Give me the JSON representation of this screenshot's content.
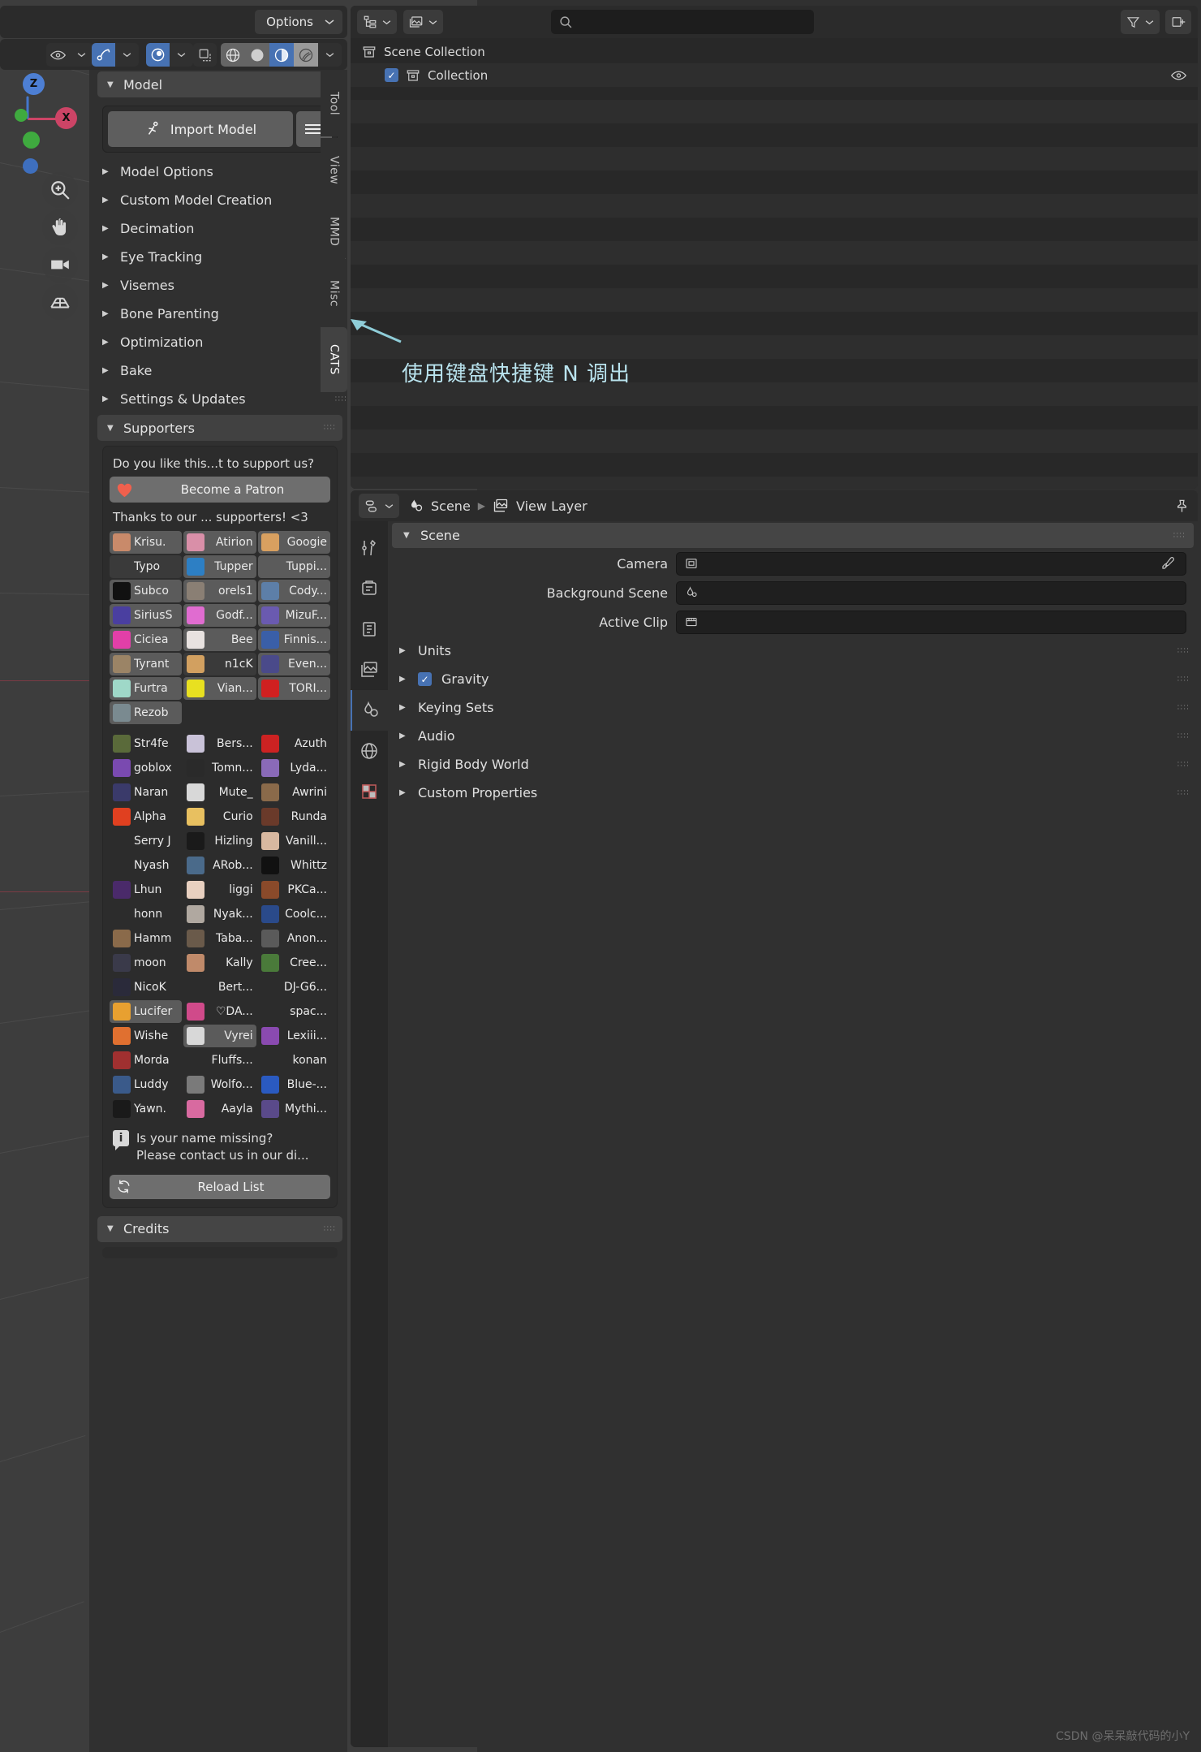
{
  "viewport": {
    "options_label": "Options",
    "gizmo": {
      "z": "Z",
      "x": "X"
    },
    "tools": [
      "zoom-tool",
      "pan-tool",
      "camera-tool",
      "grid-tool"
    ],
    "header_icons": [
      "visibility-dropdown",
      "snap-magnet",
      "snap-dropdown",
      "proportional-edit",
      "proportional-dropdown",
      "overlays-toggle",
      "wireframe-shading",
      "solid-shading",
      "material-shading",
      "rendered-shading",
      "shading-dropdown"
    ]
  },
  "cats_panel": {
    "tabs": [
      {
        "label": "Tool",
        "active": false
      },
      {
        "label": "View",
        "active": false
      },
      {
        "label": "MMD",
        "active": false
      },
      {
        "label": "Misc",
        "active": false
      },
      {
        "label": "CATS",
        "active": true
      }
    ],
    "model_header": "Model",
    "import_button": "Import Model",
    "sections": [
      {
        "label": "Model Options",
        "open": false
      },
      {
        "label": "Custom Model Creation",
        "open": false
      },
      {
        "label": "Decimation",
        "open": false
      },
      {
        "label": "Eye Tracking",
        "open": false
      },
      {
        "label": "Visemes",
        "open": false
      },
      {
        "label": "Bone Parenting",
        "open": false
      },
      {
        "label": "Optimization",
        "open": false
      },
      {
        "label": "Bake",
        "open": false
      },
      {
        "label": "Settings & Updates",
        "open": false
      },
      {
        "label": "Supporters",
        "open": true
      }
    ],
    "supporters": {
      "prompt": "Do you like this...t to support us?",
      "patron_button": "Become a Patron",
      "patron_icon": "heart-icon",
      "thanks": "Thanks to our ... supporters! <3",
      "top_rows": [
        [
          {
            "name": "Krisu.",
            "avatar": "#c98a6a",
            "style": "light"
          },
          {
            "name": "Atirion",
            "avatar": "#d98fa8",
            "style": "light"
          },
          {
            "name": "Googie",
            "avatar": "#d8a060",
            "style": "light"
          }
        ],
        [
          {
            "name": "Typo",
            "avatar": "",
            "style": "dark"
          },
          {
            "name": "Tupper",
            "avatar": "#2d7fc4",
            "style": "light"
          },
          {
            "name": "Tuppi...",
            "avatar": "",
            "style": "light"
          }
        ],
        [
          {
            "name": "Subco",
            "avatar": "#111111",
            "style": "light"
          },
          {
            "name": "orels1",
            "avatar": "#8a7f74",
            "style": "light"
          },
          {
            "name": "Cody...",
            "avatar": "#5d7fa8",
            "style": "light"
          }
        ],
        [
          {
            "name": "SiriusS",
            "avatar": "#4a3fa0",
            "style": "light"
          },
          {
            "name": "Godf...",
            "avatar": "#e06cd0",
            "style": "light"
          },
          {
            "name": "MizuF...",
            "avatar": "#6a5ab0",
            "style": "light"
          }
        ],
        [
          {
            "name": "Ciciea",
            "avatar": "#e23fa8",
            "style": "light"
          },
          {
            "name": "Bee",
            "avatar": "#e8e2e0",
            "style": "light"
          },
          {
            "name": "Finnis...",
            "avatar": "#3a5fa8",
            "style": "light"
          }
        ],
        [
          {
            "name": "Tyrant",
            "avatar": "#9b8466",
            "style": "light"
          },
          {
            "name": "n1cK",
            "avatar": "#d2a060",
            "style": "dark"
          },
          {
            "name": "Even...",
            "avatar": "#4a4a8a",
            "style": "light"
          }
        ],
        [
          {
            "name": "Furtra",
            "avatar": "#9fd8c8",
            "style": "light"
          },
          {
            "name": "Vian...",
            "avatar": "#e8e020",
            "style": "light"
          },
          {
            "name": "TORI...",
            "avatar": "#d02020",
            "style": "light"
          }
        ],
        [
          {
            "name": "Rezob",
            "avatar": "#7a8a90",
            "style": "light"
          },
          {
            "name": "",
            "avatar": "",
            "style": "flat"
          },
          {
            "name": "",
            "avatar": "",
            "style": "flat"
          }
        ]
      ],
      "bottom_rows": [
        [
          {
            "name": "Str4fe",
            "avatar": "#5a6a3a"
          },
          {
            "name": "Bers...",
            "avatar": "#c9c2d8"
          },
          {
            "name": "Azuth",
            "avatar": "#cc2222"
          }
        ],
        [
          {
            "name": "goblox",
            "avatar": "#7a4ab0"
          },
          {
            "name": "Tomn...",
            "avatar": "#2a2a2a"
          },
          {
            "name": "Lyda...",
            "avatar": "#8a6ab8"
          }
        ],
        [
          {
            "name": "Naran",
            "avatar": "#3a3a6a"
          },
          {
            "name": "Mute_",
            "avatar": "#d8d8d8"
          },
          {
            "name": "Awrini",
            "avatar": "#8a6a4a"
          }
        ],
        [
          {
            "name": "Alpha",
            "avatar": "#e04020"
          },
          {
            "name": "Curio",
            "avatar": "#e8c060"
          },
          {
            "name": "Runda",
            "avatar": "#6a3a2a"
          }
        ],
        [
          {
            "name": "Serry J",
            "avatar": ""
          },
          {
            "name": "Hizling",
            "avatar": "#1a1a1a"
          },
          {
            "name": "Vanill...",
            "avatar": "#d8b8a0"
          }
        ],
        [
          {
            "name": "Nyash",
            "avatar": ""
          },
          {
            "name": "ARob...",
            "avatar": "#4a6a8a"
          },
          {
            "name": "Whittz",
            "avatar": "#111111"
          }
        ],
        [
          {
            "name": "Lhun",
            "avatar": "#4a2a6a"
          },
          {
            "name": "liggi",
            "avatar": "#e8d0c0"
          },
          {
            "name": "PKCa...",
            "avatar": "#8a4a2a"
          }
        ],
        [
          {
            "name": "honn",
            "avatar": ""
          },
          {
            "name": "Nyak...",
            "avatar": "#b0a8a0"
          },
          {
            "name": "Coolc...",
            "avatar": "#2a4a8a"
          }
        ],
        [
          {
            "name": "Hamm",
            "avatar": "#8a6a4a"
          },
          {
            "name": "Taba...",
            "avatar": "#6a5a4a"
          },
          {
            "name": "Anon...",
            "avatar": "#5a5a5a"
          }
        ],
        [
          {
            "name": "moon",
            "avatar": "#3a3a4a"
          },
          {
            "name": "Kally",
            "avatar": "#c08a6a"
          },
          {
            "name": "Cree...",
            "avatar": "#4a7a3a"
          }
        ],
        [
          {
            "name": "NicoK",
            "avatar": "#2a2a3a"
          },
          {
            "name": "Bert...",
            "avatar": ""
          },
          {
            "name": "DJ-G6...",
            "avatar": ""
          }
        ],
        [
          {
            "name": "Lucifer",
            "avatar": "#e8a030",
            "highlight": true
          },
          {
            "name": "♡DA...",
            "avatar": "#d04a8a"
          },
          {
            "name": "spac...",
            "avatar": ""
          }
        ],
        [
          {
            "name": "Wishe",
            "avatar": "#e07030"
          },
          {
            "name": "Vyrei",
            "avatar": "#d8d8d8",
            "highlight": true
          },
          {
            "name": "Lexiii...",
            "avatar": "#8a4ab0"
          }
        ],
        [
          {
            "name": "Morda",
            "avatar": "#a03030"
          },
          {
            "name": "Fluffs...",
            "avatar": ""
          },
          {
            "name": "konan",
            "avatar": ""
          }
        ],
        [
          {
            "name": "Luddy",
            "avatar": "#3a5a8a"
          },
          {
            "name": "Wolfo...",
            "avatar": "#7a7a7a"
          },
          {
            "name": "Blue-...",
            "avatar": "#2a5ac0"
          }
        ],
        [
          {
            "name": "Yawn.",
            "avatar": "#1a1a1a"
          },
          {
            "name": "Aayla",
            "avatar": "#d86aa0"
          },
          {
            "name": "Mythi...",
            "avatar": "#5a4a8a"
          }
        ]
      ],
      "missing_line1": "Is your name missing?",
      "missing_line2": "Please contact us in our di...",
      "info_icon": "info-icon",
      "reload_button": "Reload List",
      "reload_icon": "refresh-icon"
    },
    "credits_header": "Credits"
  },
  "outliner": {
    "display_mode_icon": "outliner-display-mode",
    "filter_id_icon": "outliner-id-type",
    "search_placeholder": "",
    "search_icon": "search-icon",
    "filter_icon": "funnel-icon",
    "new_collection_icon": "new-collection-icon",
    "rows": [
      {
        "label": "Scene Collection",
        "icon": "scene-collection-icon",
        "indent": false,
        "checkbox": false,
        "eye": false
      },
      {
        "label": "Collection",
        "icon": "collection-icon",
        "indent": true,
        "checkbox": true,
        "eye": true
      }
    ]
  },
  "annotation": {
    "text": "使用键盘快捷键 N 调出",
    "color": "#b9e3ee"
  },
  "properties": {
    "editor_type_icon": "properties-editor-icon",
    "breadcrumb": [
      {
        "label": "Scene",
        "icon": "scene-icon"
      },
      {
        "label": "View Layer",
        "icon": "view-layer-icon"
      }
    ],
    "pin_icon": "pin-icon",
    "tabs": [
      {
        "icon": "tool-icon",
        "name": "tool",
        "active": false
      },
      {
        "icon": "render-icon",
        "name": "render",
        "active": false
      },
      {
        "icon": "output-icon",
        "name": "output",
        "active": false
      },
      {
        "icon": "view-layer-icon",
        "name": "view-layer",
        "active": false
      },
      {
        "icon": "scene-icon",
        "name": "scene",
        "active": true
      },
      {
        "icon": "world-icon",
        "name": "world",
        "active": false
      },
      {
        "icon": "texture-icon",
        "name": "texture",
        "active": false
      }
    ],
    "section_title": "Scene",
    "fields": [
      {
        "label": "Camera",
        "value": "",
        "icon": "camera-data-icon",
        "eyedropper": true
      },
      {
        "label": "Background Scene",
        "value": "",
        "icon": "scene-icon",
        "eyedropper": false
      },
      {
        "label": "Active Clip",
        "value": "",
        "icon": "clip-icon",
        "eyedropper": false
      }
    ],
    "collapsed_sections": [
      {
        "label": "Units",
        "checkbox": false
      },
      {
        "label": "Gravity",
        "checkbox": true
      },
      {
        "label": "Keying Sets",
        "checkbox": false
      },
      {
        "label": "Audio",
        "checkbox": false
      },
      {
        "label": "Rigid Body World",
        "checkbox": false
      },
      {
        "label": "Custom Properties",
        "checkbox": false
      }
    ]
  },
  "watermark": "CSDN @呆呆敲代码的小Y"
}
